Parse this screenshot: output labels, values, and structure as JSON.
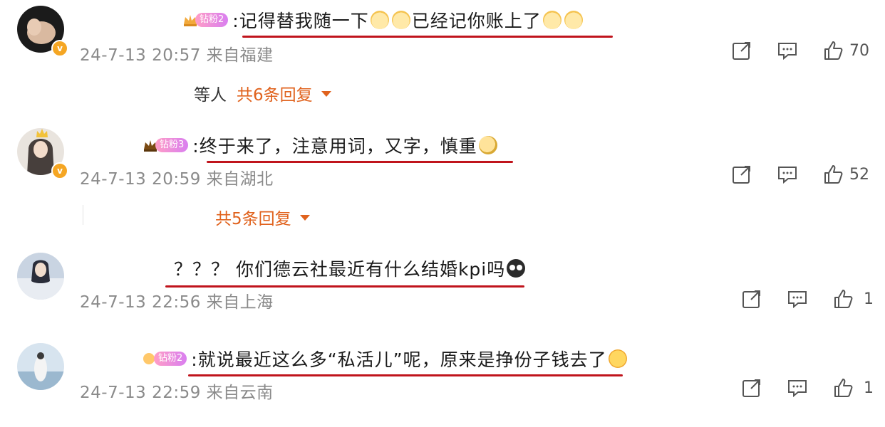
{
  "comments": [
    {
      "fan_badge": "钻粉2",
      "text_a": ":记得替我随一下",
      "text_b": "已经记你账上了",
      "timestamp": "24-7-13 20:57",
      "location": "来自福建",
      "likes": "70",
      "reply_who": "等人",
      "reply_total": "共6条回复"
    },
    {
      "fan_badge": "钻粉3",
      "text_a": ":终于来了，注意用词，又字，慎重",
      "timestamp": "24-7-13 20:59",
      "location": "来自湖北",
      "likes": "52",
      "reply_total": "共5条回复"
    },
    {
      "text_a": "？？？ 你们德云社最近有什么结婚kpi吗",
      "timestamp": "24-7-13 22:56",
      "location": "来自上海",
      "likes": "1"
    },
    {
      "fan_badge": "钻粉2",
      "text_a": ":就说最近这么多“私活儿”呢，原来是挣份子钱去了",
      "timestamp": "24-7-13 22:59",
      "location": "来自云南",
      "likes": "1"
    }
  ],
  "icons": {
    "share": "share-icon",
    "comment": "comment-icon",
    "like": "thumbs-up-icon",
    "verified": "verified-badge-icon",
    "expand": "chevron-down-icon"
  },
  "colors": {
    "underline": "#c0141c",
    "reply_link": "#e0621d",
    "meta_text": "#8a8a8a",
    "verified_badge": "#f5a623"
  }
}
